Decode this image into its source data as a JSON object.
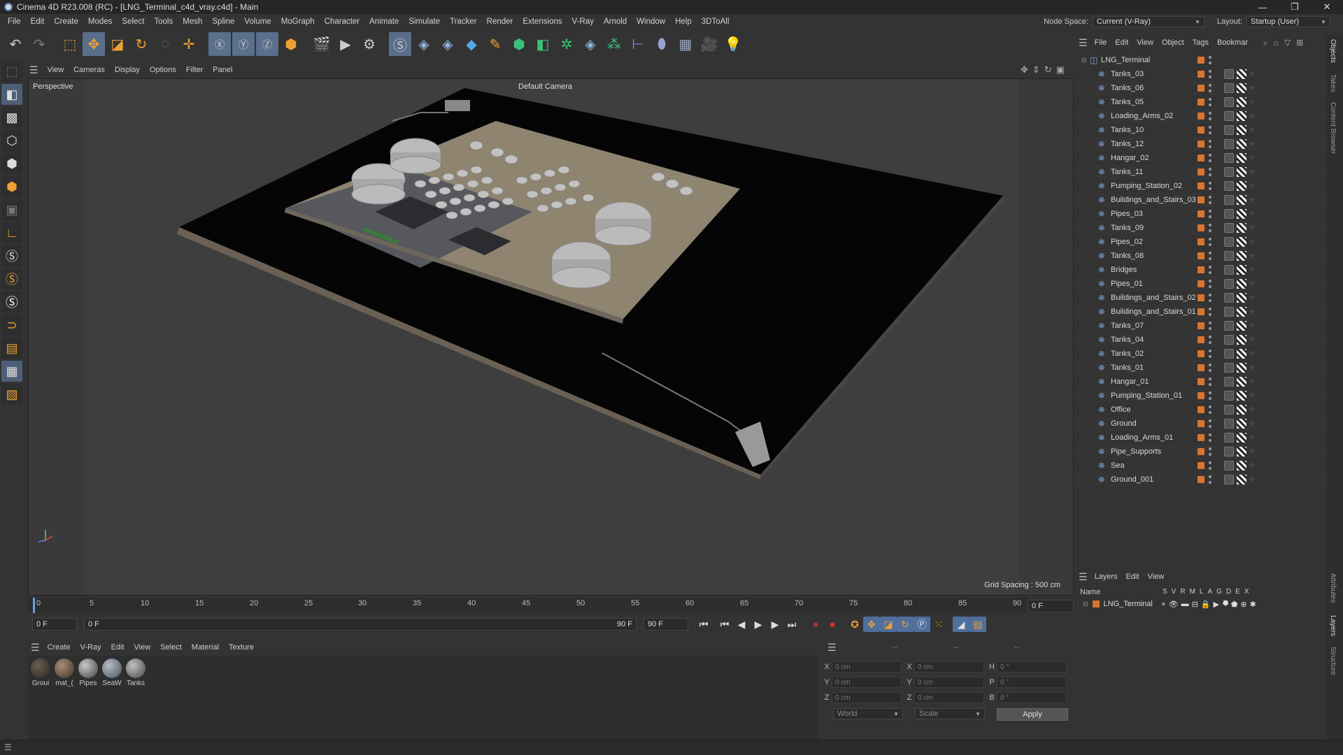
{
  "window": {
    "title": "Cinema 4D R23.008 (RC) - [LNG_Terminal_c4d_vray.c4d] - Main",
    "controls": [
      "—",
      "❐",
      "✕"
    ]
  },
  "menubar": {
    "items": [
      "File",
      "Edit",
      "Create",
      "Modes",
      "Select",
      "Tools",
      "Mesh",
      "Spline",
      "Volume",
      "MoGraph",
      "Character",
      "Animate",
      "Simulate",
      "Tracker",
      "Render",
      "Extensions",
      "V-Ray",
      "Arnold",
      "Window",
      "Help",
      "3DToAll"
    ],
    "node_space_label": "Node Space:",
    "node_space_value": "Current (V-Ray)",
    "layout_label": "Layout:",
    "layout_value": "Startup (User)"
  },
  "viewport": {
    "menu": [
      "View",
      "Cameras",
      "Display",
      "Options",
      "Filter",
      "Panel"
    ],
    "label": "Perspective",
    "camera": "Default Camera",
    "grid_spacing": "Grid Spacing : 500 cm"
  },
  "timeline": {
    "ticks": [
      "0",
      "5",
      "10",
      "15",
      "20",
      "25",
      "30",
      "35",
      "40",
      "45",
      "50",
      "55",
      "60",
      "65",
      "70",
      "75",
      "80",
      "85",
      "90"
    ],
    "current_frame": "0 F",
    "start_frame": "0 F",
    "range_start": "0 F",
    "range_end": "90 F",
    "end_frame": "90 F"
  },
  "material_manager": {
    "menu": [
      "Create",
      "V-Ray",
      "Edit",
      "View",
      "Select",
      "Material",
      "Texture"
    ],
    "materials": [
      {
        "name": "Groui",
        "color": "#3b352d"
      },
      {
        "name": "mat_(",
        "color": "#6b5a48"
      },
      {
        "name": "Pipes",
        "color": "#7a7a7a"
      },
      {
        "name": "SeaW",
        "color": "#7f8891"
      },
      {
        "name": "Tanks",
        "color": "#8a8a8a"
      }
    ]
  },
  "coordinates": {
    "header": [
      "--",
      "--",
      "--"
    ],
    "rows": [
      {
        "a1": "X",
        "v1": "0 cm",
        "a2": "X",
        "v2": "0 cm",
        "a3": "H",
        "v3": "0 °"
      },
      {
        "a1": "Y",
        "v1": "0 cm",
        "a2": "Y",
        "v2": "0 cm",
        "a3": "P",
        "v3": "0 °"
      },
      {
        "a1": "Z",
        "v1": "0 cm",
        "a2": "Z",
        "v2": "0 cm",
        "a3": "B",
        "v3": "0 °"
      }
    ],
    "mode": "World",
    "scale": "Scale",
    "apply": "Apply"
  },
  "object_manager": {
    "menu": [
      "File",
      "Edit",
      "View",
      "Object",
      "Tags",
      "Bookmar"
    ],
    "root": "LNG_Terminal",
    "objects": [
      "Tanks_03",
      "Tanks_06",
      "Tanks_05",
      "Loading_Arms_02",
      "Tanks_10",
      "Tanks_12",
      "Hangar_02",
      "Tanks_11",
      "Pumping_Station_02",
      "Buildings_and_Stairs_03",
      "Pipes_03",
      "Tanks_09",
      "Pipes_02",
      "Tanks_08",
      "Bridges",
      "Pipes_01",
      "Buildings_and_Stairs_02",
      "Buildings_and_Stairs_01",
      "Tanks_07",
      "Tanks_04",
      "Tanks_02",
      "Tanks_01",
      "Hangar_01",
      "Pumping_Station_01",
      "Office",
      "Ground",
      "Loading_Arms_01",
      "Pipe_Supports",
      "Sea",
      "Ground_001"
    ]
  },
  "layers": {
    "menu": [
      "Layers",
      "Edit",
      "View"
    ],
    "header_name": "Name",
    "flags": [
      "S",
      "V",
      "R",
      "M",
      "L",
      "A",
      "G",
      "D",
      "E",
      "X"
    ],
    "rows": [
      {
        "name": "LNG_Terminal"
      }
    ]
  },
  "side_tabs": [
    "Objects",
    "Takes",
    "Content Browser",
    "Attributes",
    "Layers",
    "Structure"
  ],
  "colors": {
    "accent": "#5a6f8c",
    "object_color": "#d9752e",
    "playhead": "#6aa0e8"
  }
}
